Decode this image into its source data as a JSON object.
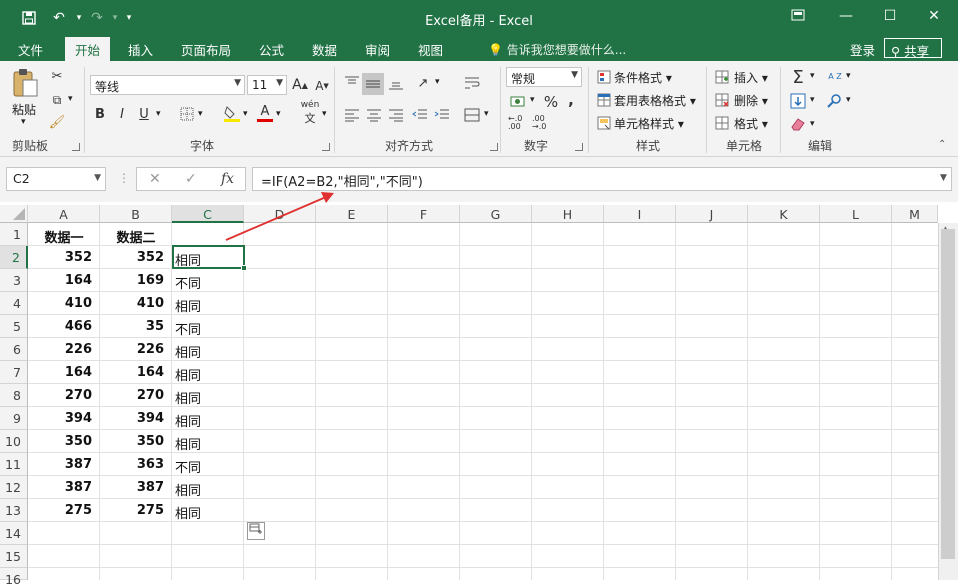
{
  "window": {
    "title": "Excel备用 - Excel",
    "qat": {
      "save_icon": "save-icon",
      "undo_icon": "undo-icon",
      "redo_icon": "redo-icon",
      "customize": "▾"
    },
    "controls": {
      "ribbon_display": "ribbon-display-icon",
      "minimize": "—",
      "maximize": "☐",
      "close": "✕"
    }
  },
  "tabs": [
    {
      "label": "文件"
    },
    {
      "label": "开始"
    },
    {
      "label": "插入"
    },
    {
      "label": "页面布局"
    },
    {
      "label": "公式"
    },
    {
      "label": "数据"
    },
    {
      "label": "审阅"
    },
    {
      "label": "视图"
    }
  ],
  "tellme": "告诉我您想要做什么...",
  "account": {
    "login": "登录",
    "share": "共享"
  },
  "ribbon": {
    "clipboard": {
      "paste": "粘贴",
      "label": "剪贴板"
    },
    "font": {
      "name": "等线",
      "size": "11",
      "grow": "A",
      "shrink": "A",
      "bold": "B",
      "italic": "I",
      "underline": "U",
      "font_color": "A",
      "wen": "wén",
      "label": "字体"
    },
    "alignment": {
      "label": "对齐方式"
    },
    "number": {
      "format": "常规",
      "percent": "%",
      "comma": ",",
      "inc_dec": "←.0 .00",
      "dec_dec": ".00 →.0",
      "label": "数字"
    },
    "styles": {
      "conditional": "条件格式",
      "table": "套用表格格式",
      "cell": "单元格样式",
      "label": "样式"
    },
    "cells": {
      "insert": "插入",
      "delete": "删除",
      "format": "格式",
      "label": "单元格"
    },
    "editing": {
      "sum": "Σ",
      "sort": "A Z",
      "label": "编辑"
    }
  },
  "formula_bar": {
    "name_box": "C2",
    "cancel": "✕",
    "enter": "✓",
    "fx": "fx",
    "formula": "=IF(A2=B2,\"相同\",\"不同\")"
  },
  "sheet": {
    "columns": [
      "A",
      "B",
      "C",
      "D",
      "E",
      "F",
      "G",
      "H",
      "I",
      "J",
      "K",
      "L",
      "M"
    ],
    "rows": [
      "1",
      "2",
      "3",
      "4",
      "5",
      "6",
      "7",
      "8",
      "9",
      "10",
      "11",
      "12",
      "13",
      "14",
      "15",
      "16"
    ],
    "header": [
      "数据一",
      "数据二"
    ],
    "data": [
      {
        "a": "352",
        "b": "352",
        "c": "相同"
      },
      {
        "a": "164",
        "b": "169",
        "c": "不同"
      },
      {
        "a": "410",
        "b": "410",
        "c": "相同"
      },
      {
        "a": "466",
        "b": "35",
        "c": "不同"
      },
      {
        "a": "226",
        "b": "226",
        "c": "相同"
      },
      {
        "a": "164",
        "b": "164",
        "c": "相同"
      },
      {
        "a": "270",
        "b": "270",
        "c": "相同"
      },
      {
        "a": "394",
        "b": "394",
        "c": "相同"
      },
      {
        "a": "350",
        "b": "350",
        "c": "相同"
      },
      {
        "a": "387",
        "b": "363",
        "c": "不同"
      },
      {
        "a": "387",
        "b": "387",
        "c": "相同"
      },
      {
        "a": "275",
        "b": "275",
        "c": "相同"
      }
    ],
    "selected_cell": "C2",
    "annotation_color": "#e03030",
    "accent_color": "#217346"
  }
}
